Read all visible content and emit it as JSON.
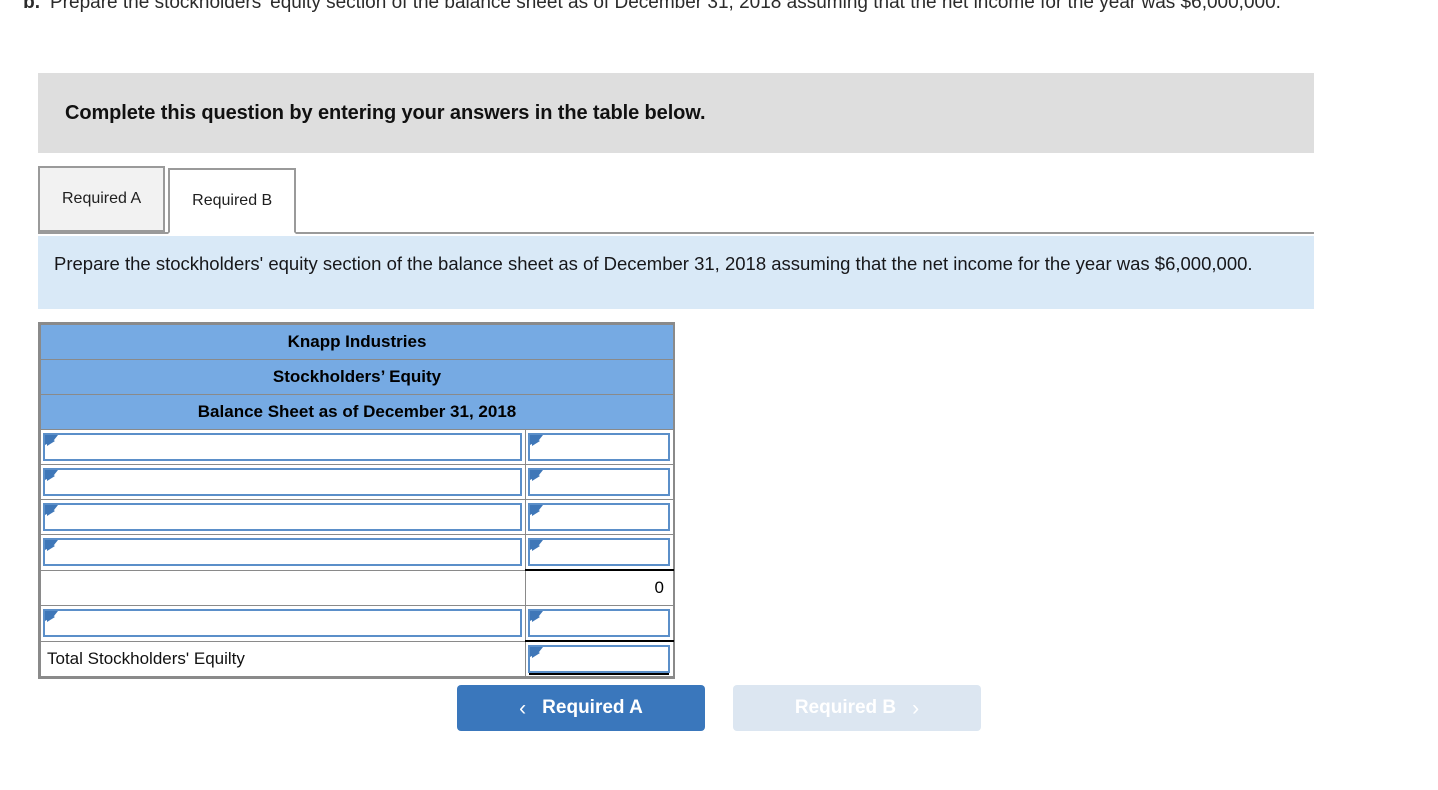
{
  "question": {
    "letter": "b.",
    "text": "Prepare the stockholders' equity section of the balance sheet as of December 31, 2018 assuming that the net income for the year was $6,000,000."
  },
  "banner": {
    "text": "Complete this question by entering your answers in the table below."
  },
  "tabs": [
    {
      "label": "Required A",
      "active": false
    },
    {
      "label": "Required B",
      "active": true
    }
  ],
  "requirement_panel": {
    "text": "Prepare the stockholders' equity section of the balance sheet as of December 31, 2018 assuming that the net income for the year was $6,000,000."
  },
  "worksheet": {
    "headers": [
      "Knapp Industries",
      "Stockholders’ Equity",
      "Balance Sheet as of December 31, 2018"
    ],
    "rows": [
      {
        "label": "",
        "label_type": "dropdown",
        "value": "",
        "value_type": "dropdown"
      },
      {
        "label": "",
        "label_type": "dropdown",
        "value": "",
        "value_type": "dropdown"
      },
      {
        "label": "",
        "label_type": "dropdown",
        "value": "",
        "value_type": "dropdown"
      },
      {
        "label": "",
        "label_type": "dropdown",
        "value": "",
        "value_type": "dropdown"
      },
      {
        "label": "",
        "label_type": "blank",
        "value": "0",
        "value_type": "computed"
      },
      {
        "label": "",
        "label_type": "dropdown",
        "value": "",
        "value_type": "dropdown"
      },
      {
        "label": "Total Stockholders' Equilty",
        "label_type": "text",
        "value": "",
        "value_type": "total"
      }
    ]
  },
  "nav": {
    "prev": {
      "label": "Required A",
      "icon": "chevron-left",
      "glyph": "‹",
      "state": "enabled"
    },
    "next": {
      "label": "Required B",
      "icon": "chevron-right",
      "glyph": "›",
      "state": "disabled"
    }
  },
  "colors": {
    "header_blue": "#76aae3",
    "panel_blue": "#d9e9f7",
    "banner_gray": "#dedede",
    "button_blue": "#3a77bc",
    "button_disabled": "#dce6f1",
    "input_border": "#5b8fc9"
  }
}
